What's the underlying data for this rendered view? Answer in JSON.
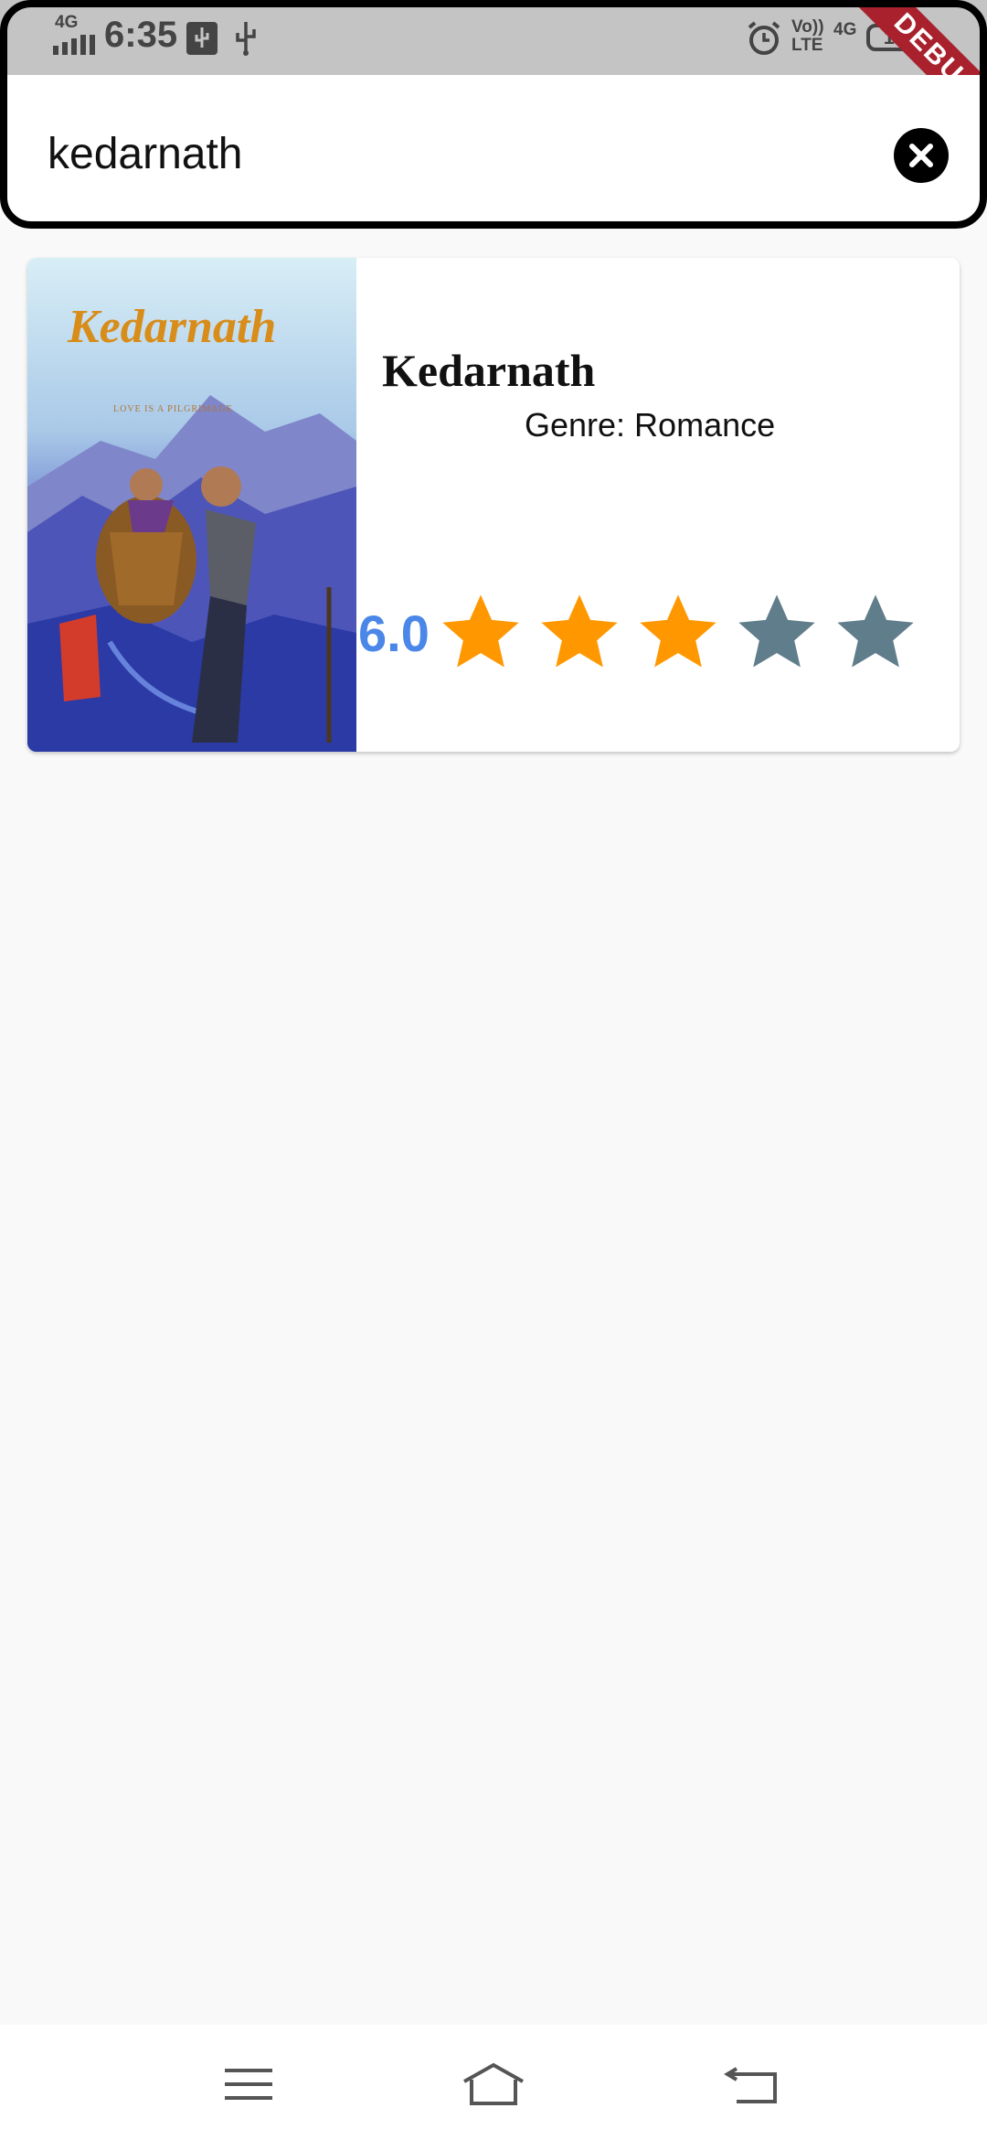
{
  "status_bar": {
    "network": "4G",
    "time": "6:35",
    "volte": "Vo))\nLTE",
    "signal_4g": "4G",
    "battery": "100",
    "debug_banner": "DEBUG"
  },
  "search": {
    "query": "kedarnath"
  },
  "results": [
    {
      "title": "Kedarnath",
      "genre": "Genre: Romance",
      "rating": "6.0",
      "stars_filled": 3,
      "stars_total": 5,
      "poster_title": "Kedarnath",
      "poster_tagline": "LOVE IS A PILGRIMAGE"
    }
  ],
  "colors": {
    "star_filled": "#ff9800",
    "star_empty": "#607d8b",
    "rating_text": "#4a87e8",
    "debug_ribbon": "#a8212d"
  },
  "icons": {
    "clear": "close-circle-icon",
    "nav_menu": "menu-icon",
    "nav_home": "home-icon",
    "nav_back": "back-icon"
  }
}
